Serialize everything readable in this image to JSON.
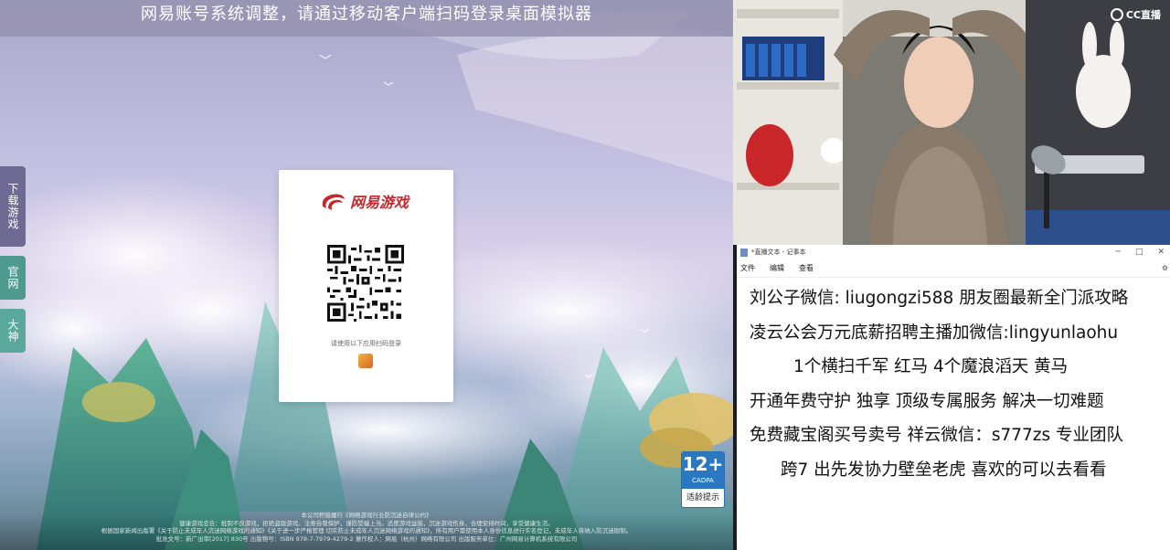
{
  "game": {
    "notice": "网易账号系统调整，请通过移动客户端扫码登录桌面模拟器",
    "side_tabs": [
      "下载游戏",
      "官网",
      "大神"
    ],
    "login_card": {
      "brand": "网易游戏",
      "qr_hint": "请使用以下应用扫码登录"
    },
    "age_rating": {
      "number": "12+",
      "org": "CADPA",
      "label": "适龄提示"
    },
    "footer_lines": [
      "本公司积极履行《网络游戏行业防沉迷自律公约》",
      "健康游戏忠告：抵制不良游戏，拒绝盗版游戏。注意自我保护，谨防受骗上当。适度游戏益脑，沉迷游戏伤身。合理安排时间，享受健康生活。",
      "根据国家新闻出版署《关于防止未成年人沉迷网络游戏的通知》《关于进一步严格管理 切实防止未成年人沉迷网络游戏的通知》，所有用户需使用本人身份信息进行实名登记，未成年人将纳入防沉迷限制。",
      "批准文号：新广出审[2017] 830号 出版物号：ISBN 978-7-7979-4279-2 著作权人：网易（杭州）网络有限公司 出版服务单位：广州网易计算机系统有限公司"
    ]
  },
  "stream": {
    "platform": "CC直播"
  },
  "notepad": {
    "title": "*直播文本 - 记事本",
    "menu": [
      "文件",
      "编辑",
      "查看"
    ],
    "lines": [
      "刘公子微信: liugongzi588 朋友圈最新全门派攻略",
      "凌云公会万元底薪招聘主播加微信:lingyunlaohu",
      "1个横扫千军 红马   4个魔浪滔天 黄马",
      "开通年费守护  独享  顶级专属服务 解决一切难题",
      "免费藏宝阁买号卖号 祥云微信：s777zs 专业团队",
      "跨7 出先发协力壁垒老虎 喜欢的可以去看看"
    ],
    "colors": {
      "background": "#ffffff",
      "text": "#111111"
    }
  },
  "colors": {
    "notice_bar": "#9692b0",
    "tab_download": "#6f6a93",
    "tab_official": "#4f9a8e",
    "brand_red": "#c8262a",
    "age_blue": "#2b78c2"
  }
}
